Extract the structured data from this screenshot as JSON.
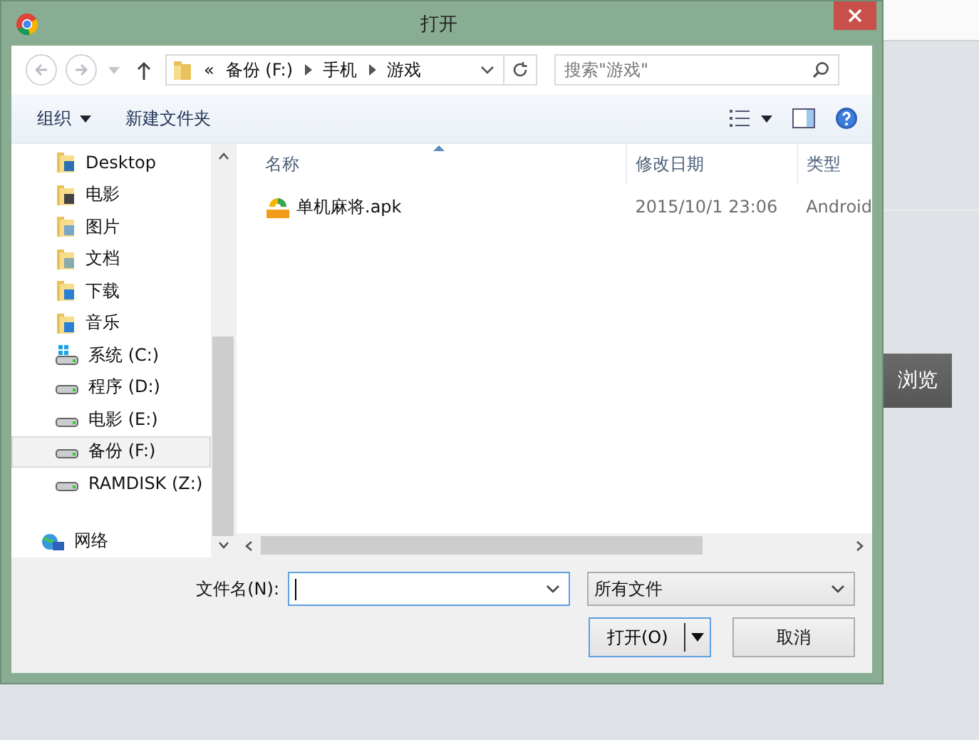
{
  "window": {
    "title": "打开"
  },
  "navigation": {
    "overflow": "«",
    "path": [
      "备份 (F:)",
      "手机",
      "游戏"
    ],
    "search": {
      "placeholder": "搜索\"游戏\""
    }
  },
  "toolbar": {
    "organize": "组织",
    "new_folder": "新建文件夹"
  },
  "sidebar": {
    "items": [
      {
        "label": "Desktop",
        "kind": "desktop",
        "selected": false
      },
      {
        "label": "电影",
        "kind": "videos",
        "selected": false
      },
      {
        "label": "图片",
        "kind": "pictures",
        "selected": false
      },
      {
        "label": "文档",
        "kind": "documents",
        "selected": false
      },
      {
        "label": "下载",
        "kind": "downloads",
        "selected": false
      },
      {
        "label": "音乐",
        "kind": "music",
        "selected": false
      },
      {
        "label": "系统 (C:)",
        "kind": "system-drive",
        "selected": false
      },
      {
        "label": "程序 (D:)",
        "kind": "drive",
        "selected": false
      },
      {
        "label": "电影 (E:)",
        "kind": "drive",
        "selected": false
      },
      {
        "label": "备份 (F:)",
        "kind": "drive",
        "selected": true
      },
      {
        "label": "RAMDISK (Z:)",
        "kind": "drive",
        "selected": false
      },
      {
        "label": "网络",
        "kind": "network",
        "selected": false
      }
    ]
  },
  "table": {
    "columns": [
      "名称",
      "修改日期",
      "类型"
    ],
    "rows": [
      {
        "name": "单机麻将.apk",
        "modified": "2015/10/1 23:06",
        "type": "Android"
      }
    ]
  },
  "footer": {
    "filename_label": "文件名(N):",
    "file_type": "所有文件",
    "open_button": "打开(O)",
    "cancel_button": "取消"
  },
  "background": {
    "browse_button": "浏览"
  }
}
